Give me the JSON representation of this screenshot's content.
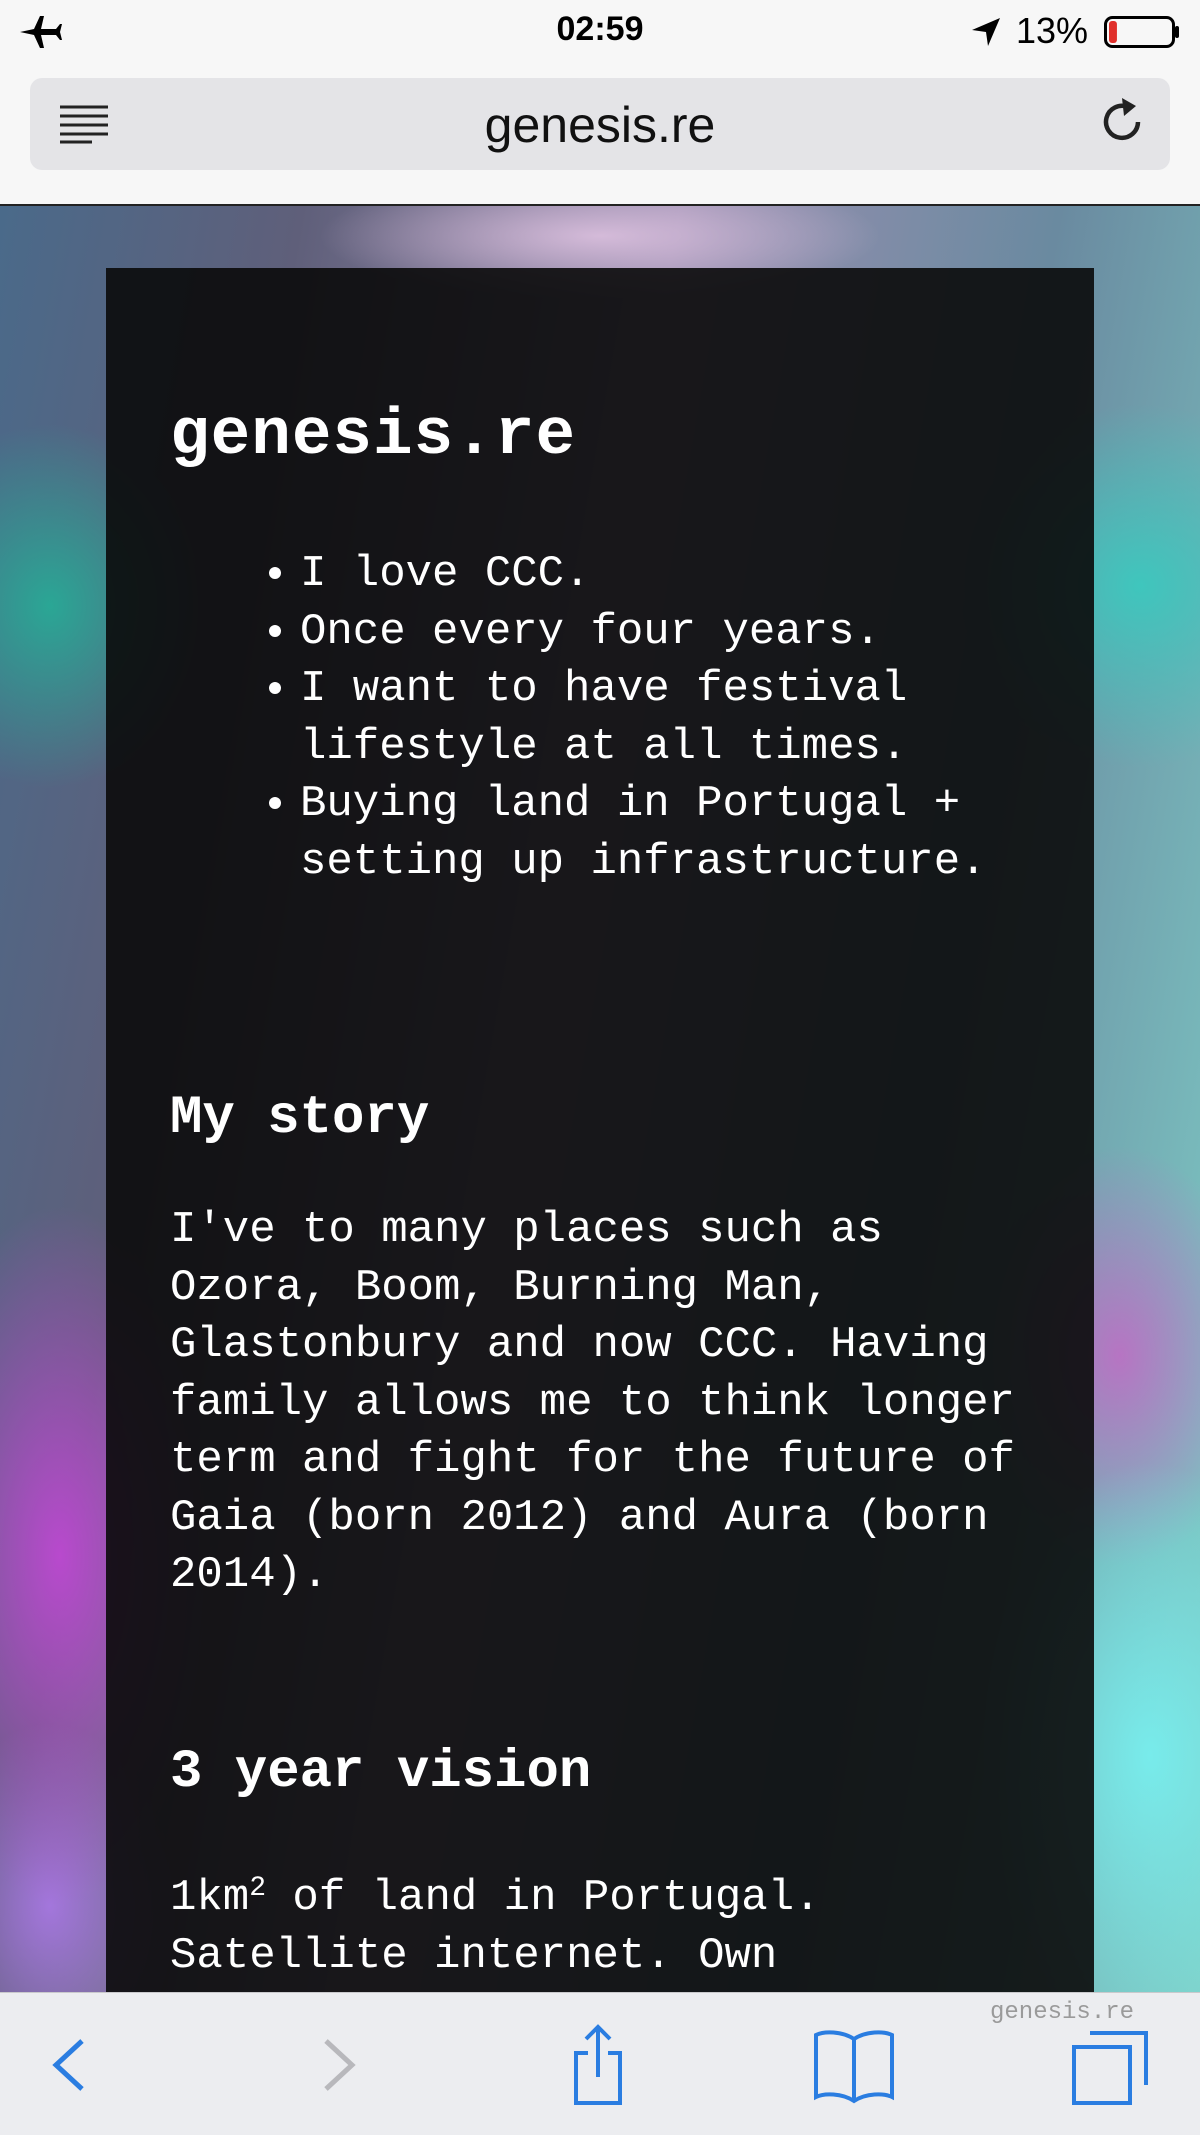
{
  "status_bar": {
    "time": "02:59",
    "battery_percent": "13%",
    "battery_level": 0.13,
    "icons": [
      "airplane-icon",
      "location-arrow-icon",
      "battery-icon"
    ]
  },
  "url_bar": {
    "url": "genesis.re",
    "icons": [
      "reader-icon",
      "reload-icon"
    ]
  },
  "page": {
    "title": "genesis.re",
    "bullets": [
      "I love CCC.",
      "Once every four years.",
      "I want to have festival lifestyle at all times.",
      "Buying land in Portugal + setting up infrastructure."
    ],
    "story_heading": "My story",
    "story_text": "I've to many places such as Ozora, Boom, Burning Man, Glastonbury and now CCC. Having family allows me to think longer term and fight for the future of Gaia (born 2012) and Aura (born 2014).",
    "vision_heading": "3 year vision",
    "vision_text_prefix": "1km",
    "vision_text_sup": "2",
    "vision_text_rest": " of land in Portugal. Satellite internet. Own"
  },
  "toolbar": {
    "watermark": "genesis.re",
    "icons": [
      "back-icon",
      "forward-icon",
      "share-icon",
      "bookmarks-icon",
      "tabs-icon"
    ],
    "accent_color": "#2a7de1",
    "disabled_color": "#b8b8bc"
  }
}
